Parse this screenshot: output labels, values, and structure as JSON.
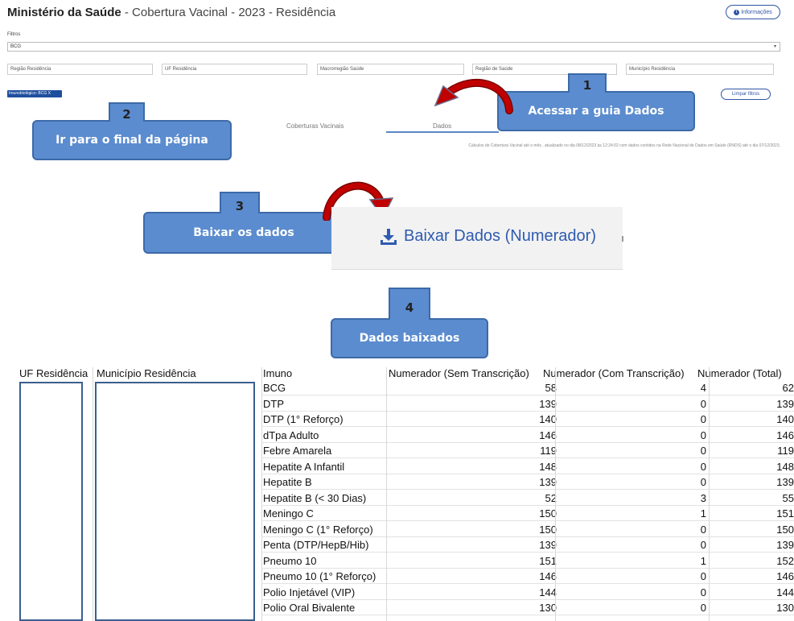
{
  "header": {
    "title_bold": "Ministério da Saúde",
    "title_rest": " - Cobertura Vacinal - 2023 - Residência",
    "info_button": "Informações"
  },
  "filters": {
    "label": "Filtros",
    "main_select_value": "BCG",
    "fields": [
      "Região Residência",
      "UF Residência",
      "Macrorregião Saúde",
      "Região de Saúde",
      "Município Residência"
    ],
    "chip": "Imunobiológico: BCG",
    "chip_close": "X",
    "clear_button": "Limpar filtros"
  },
  "tabs": [
    "Coberturas Vacinais",
    "Dados"
  ],
  "calc_note": "Cálculos de Cobertura Vacinal até o mês , atualizado no dia 08/12/2023 às 12:24:02 com dados contidos na Rede Nacional de Dados em Saúde (RNDS) até o dia 07/12/2023.",
  "callouts": [
    {
      "number": "1",
      "text": "Acessar a guia Dados"
    },
    {
      "number": "2",
      "text": "Ir para o final da página"
    },
    {
      "number": "3",
      "text": "Baixar os dados"
    },
    {
      "number": "4",
      "text": "Dados baixados"
    }
  ],
  "download": {
    "label": "Baixar Dados (Numerador)",
    "icon": "download-icon"
  },
  "colors": {
    "accent": "#2f55a4",
    "callout_fill": "#5b8ccf",
    "arrow": "#c00000"
  },
  "table": {
    "headers": [
      "UF Residência",
      "Município Residência",
      "Imuno",
      "Numerador (Sem Transcrição)",
      "Numerador (Com Transcrição)",
      "Numerador (Total)"
    ],
    "rows": [
      {
        "imuno": "BCG",
        "sem": "58",
        "com": "4",
        "total": "62"
      },
      {
        "imuno": "DTP",
        "sem": "139",
        "com": "0",
        "total": "139"
      },
      {
        "imuno": "DTP (1° Reforço)",
        "sem": "140",
        "com": "0",
        "total": "140"
      },
      {
        "imuno": "dTpa Adulto",
        "sem": "146",
        "com": "0",
        "total": "146"
      },
      {
        "imuno": "Febre Amarela",
        "sem": "119",
        "com": "0",
        "total": "119"
      },
      {
        "imuno": "Hepatite A Infantil",
        "sem": "148",
        "com": "0",
        "total": "148"
      },
      {
        "imuno": "Hepatite B",
        "sem": "139",
        "com": "0",
        "total": "139"
      },
      {
        "imuno": "Hepatite B (< 30 Dias)",
        "sem": "52",
        "com": "3",
        "total": "55"
      },
      {
        "imuno": "Meningo C",
        "sem": "150",
        "com": "1",
        "total": "151"
      },
      {
        "imuno": "Meningo C (1° Reforço)",
        "sem": "150",
        "com": "0",
        "total": "150"
      },
      {
        "imuno": "Penta (DTP/HepB/Hib)",
        "sem": "139",
        "com": "0",
        "total": "139"
      },
      {
        "imuno": "Pneumo 10",
        "sem": "151",
        "com": "1",
        "total": "152"
      },
      {
        "imuno": "Pneumo 10 (1° Reforço)",
        "sem": "146",
        "com": "0",
        "total": "146"
      },
      {
        "imuno": "Polio Injetável (VIP)",
        "sem": "144",
        "com": "0",
        "total": "144"
      },
      {
        "imuno": "Polio Oral Bivalente",
        "sem": "130",
        "com": "0",
        "total": "130"
      }
    ]
  }
}
